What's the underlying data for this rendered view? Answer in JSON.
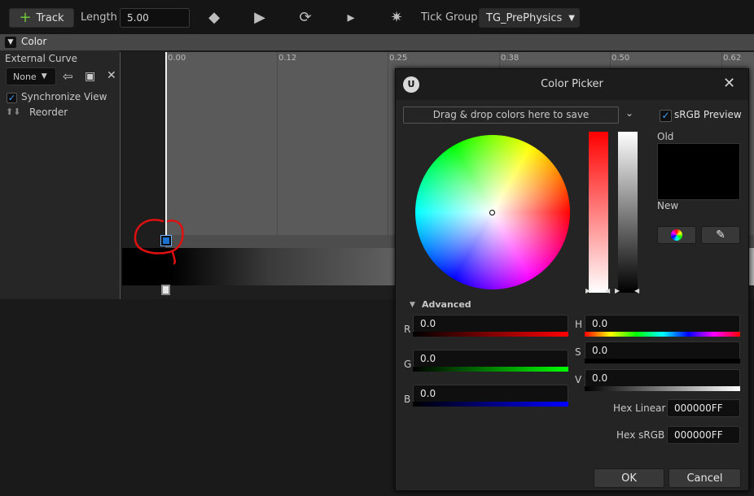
{
  "toolbar": {
    "track_label": "Track",
    "length_label": "Length",
    "length_value": "5.00",
    "tick_group_label": "Tick Group",
    "tick_group_value": "TG_PrePhysics"
  },
  "track": {
    "title": "Color",
    "external_curve_label": "External Curve",
    "curve_select": "None",
    "sync_view_label": "Synchronize View",
    "reorder_label": "Reorder",
    "ruler_ticks": [
      "0.00",
      "0.12",
      "0.25",
      "0.38",
      "0.50",
      "0.62"
    ]
  },
  "picker": {
    "title": "Color Picker",
    "drag_drop_hint": "Drag & drop colors here to save",
    "srgb_preview_label": "sRGB Preview",
    "old_label": "Old",
    "new_label": "New",
    "advanced_label": "Advanced",
    "channels": {
      "r": {
        "label": "R",
        "value": "0.0"
      },
      "g": {
        "label": "G",
        "value": "0.0"
      },
      "b": {
        "label": "B",
        "value": "0.0"
      },
      "h": {
        "label": "H",
        "value": "0.0"
      },
      "s": {
        "label": "S",
        "value": "0.0"
      },
      "v": {
        "label": "V",
        "value": "0.0"
      }
    },
    "hex_linear_label": "Hex Linear",
    "hex_linear_value": "000000FF",
    "hex_srgb_label": "Hex sRGB",
    "hex_srgb_value": "000000FF",
    "ok_label": "OK",
    "cancel_label": "Cancel"
  },
  "colors": {
    "accent": "#3ca0ff",
    "selected_key": "#1b6fd0",
    "annotation": "#e01010"
  }
}
